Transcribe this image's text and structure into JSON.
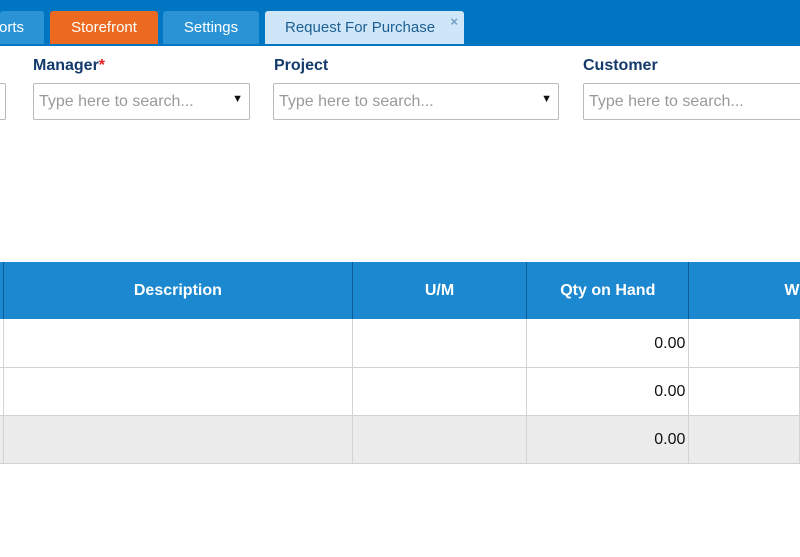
{
  "tabs": [
    {
      "label": "orts"
    },
    {
      "label": "Storefront"
    },
    {
      "label": "Settings"
    },
    {
      "label": "Request For Purchase",
      "close": "×"
    }
  ],
  "filters": {
    "manager": {
      "label": "Manager",
      "required_mark": "*",
      "placeholder": "Type here to search..."
    },
    "project": {
      "label": "Project",
      "placeholder": "Type here to search..."
    },
    "customer": {
      "label": "Customer",
      "placeholder": "Type here to search..."
    },
    "caret": "▼"
  },
  "grid": {
    "columns": [
      "",
      "Description",
      "U/M",
      "Qty on Hand",
      "W"
    ],
    "rows": [
      {
        "qty": "0.00"
      },
      {
        "qty": "0.00"
      },
      {
        "qty": "0.00"
      }
    ]
  },
  "colors": {
    "topbar": "#0075c2",
    "tab_active_orange": "#ec6a1f",
    "tab_selected": "#cfe6f8",
    "header": "#1b88cf",
    "label": "#143a6b"
  }
}
